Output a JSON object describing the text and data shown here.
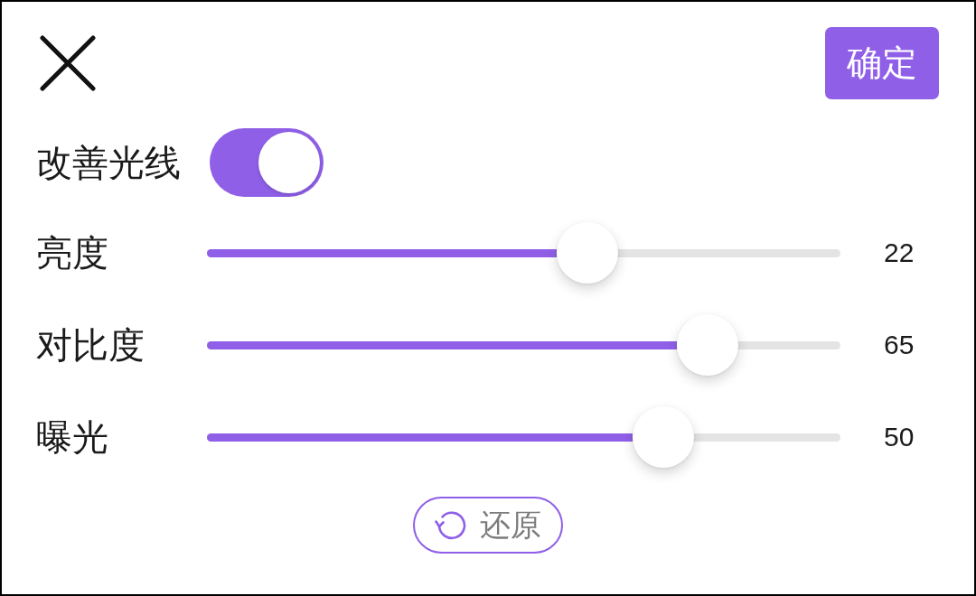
{
  "confirm_button": {
    "label": "确定"
  },
  "toggle": {
    "label": "改善光线",
    "on": true
  },
  "sliders": [
    {
      "label": "亮度",
      "level": 0.6,
      "reading": "22"
    },
    {
      "label": "对比度",
      "level": 0.79,
      "reading": "65"
    },
    {
      "label": "曝光",
      "level": 0.72,
      "reading": "50"
    }
  ],
  "reset_button": {
    "label": "还原"
  }
}
